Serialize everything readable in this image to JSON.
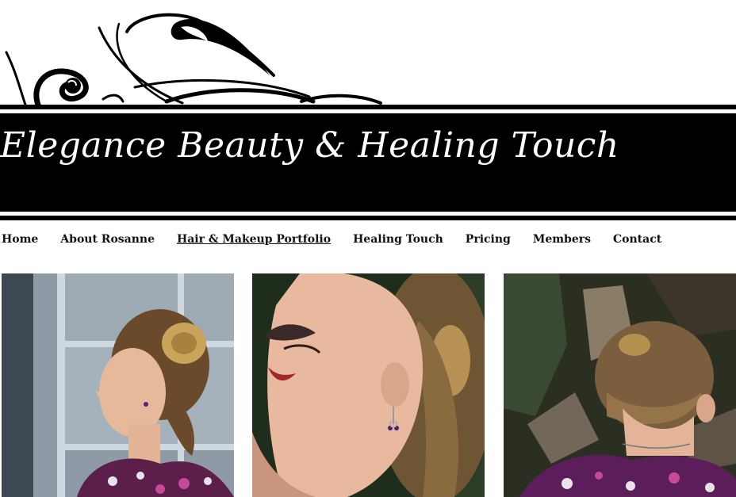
{
  "site": {
    "title": "Elegance Beauty & Healing Touch"
  },
  "nav": {
    "items": [
      {
        "label": "Home",
        "active": false
      },
      {
        "label": "About Rosanne",
        "active": false
      },
      {
        "label": "Hair & Makeup Portfolio",
        "active": true
      },
      {
        "label": "Healing Touch",
        "active": false
      },
      {
        "label": "Pricing",
        "active": false
      },
      {
        "label": "Members",
        "active": false
      },
      {
        "label": "Contact",
        "active": false
      }
    ]
  },
  "gallery": {
    "images": [
      {
        "subject": "hairstyle-profile-left"
      },
      {
        "subject": "hairstyle-upward-profile"
      },
      {
        "subject": "hairstyle-back-view"
      }
    ]
  },
  "colors": {
    "banner": "#000000",
    "title": "#ffffff",
    "nav_text": "#111111"
  }
}
